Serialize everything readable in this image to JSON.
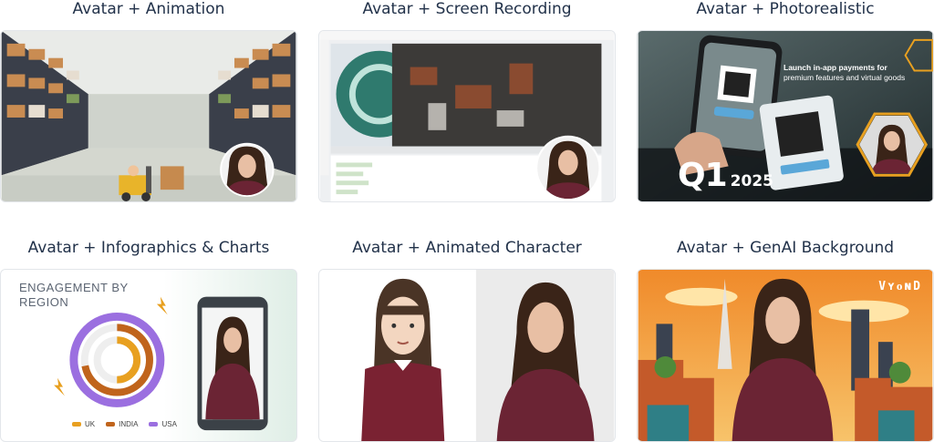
{
  "cards": [
    {
      "title": "Avatar + Animation"
    },
    {
      "title": "Avatar + Screen Recording"
    },
    {
      "title": "Avatar + Photorealistic",
      "q1": "Q1",
      "year": "2025",
      "pay_line1": "Launch in-app payments for",
      "pay_line2": "premium features and virtual goods"
    },
    {
      "title": "Avatar + Infographics & Charts",
      "chart_heading": "ENGAGEMENT BY REGION",
      "legend": [
        "UK",
        "INDIA",
        "USA"
      ]
    },
    {
      "title": "Avatar + Animated Character"
    },
    {
      "title": "Avatar + GenAI Background",
      "logo": "VYOND"
    }
  ],
  "colors": {
    "heading": "#22324a",
    "uk": "#e8a020",
    "india": "#c0641c",
    "usa": "#9b6fe0",
    "sweater": "#6b2434"
  },
  "chart_data": {
    "type": "pie",
    "title": "ENGAGEMENT BY REGION",
    "series": [
      {
        "name": "UK",
        "values": [
          0.5
        ]
      },
      {
        "name": "INDIA",
        "values": [
          0.72
        ]
      },
      {
        "name": "USA",
        "values": [
          1.0
        ]
      }
    ]
  }
}
